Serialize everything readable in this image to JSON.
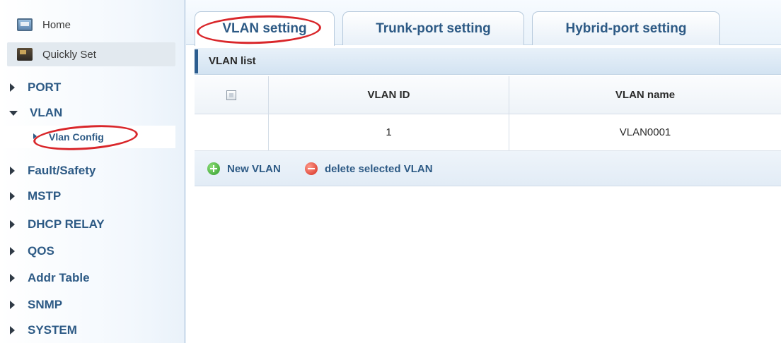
{
  "sidebar": {
    "top_items": [
      {
        "label": "Home",
        "icon": "home-icon"
      },
      {
        "label": "Quickly Set",
        "icon": "quickly-set-icon"
      }
    ],
    "menu": [
      {
        "label": "PORT",
        "expanded": false
      },
      {
        "label": "VLAN",
        "expanded": true
      },
      {
        "label": "Fault/Safety",
        "expanded": false
      },
      {
        "label": "MSTP",
        "expanded": false
      },
      {
        "label": "DHCP RELAY",
        "expanded": false
      },
      {
        "label": "QOS",
        "expanded": false
      },
      {
        "label": "Addr Table",
        "expanded": false
      },
      {
        "label": "SNMP",
        "expanded": false
      },
      {
        "label": "SYSTEM",
        "expanded": false
      }
    ],
    "vlan_submenu": [
      {
        "label": "Vlan Config",
        "selected": true
      }
    ]
  },
  "tabs": [
    {
      "label": "VLAN setting",
      "active": true
    },
    {
      "label": "Trunk-port setting",
      "active": false
    },
    {
      "label": "Hybrid-port setting",
      "active": false
    }
  ],
  "vlan_list": {
    "title": "VLAN list",
    "columns": [
      "",
      "VLAN ID",
      "VLAN name"
    ],
    "rows": [
      {
        "checked": false,
        "vlan_id": "1",
        "vlan_name": "VLAN0001"
      }
    ],
    "actions": {
      "new_label": "New VLAN",
      "delete_label": "delete selected VLAN"
    }
  },
  "annotations": {
    "highlight_color": "#d9262a",
    "highlighted": [
      "VLAN setting",
      "Vlan Config"
    ]
  },
  "colors": {
    "link_blue": "#2d5a85",
    "header_accent": "#2c5d8f"
  }
}
